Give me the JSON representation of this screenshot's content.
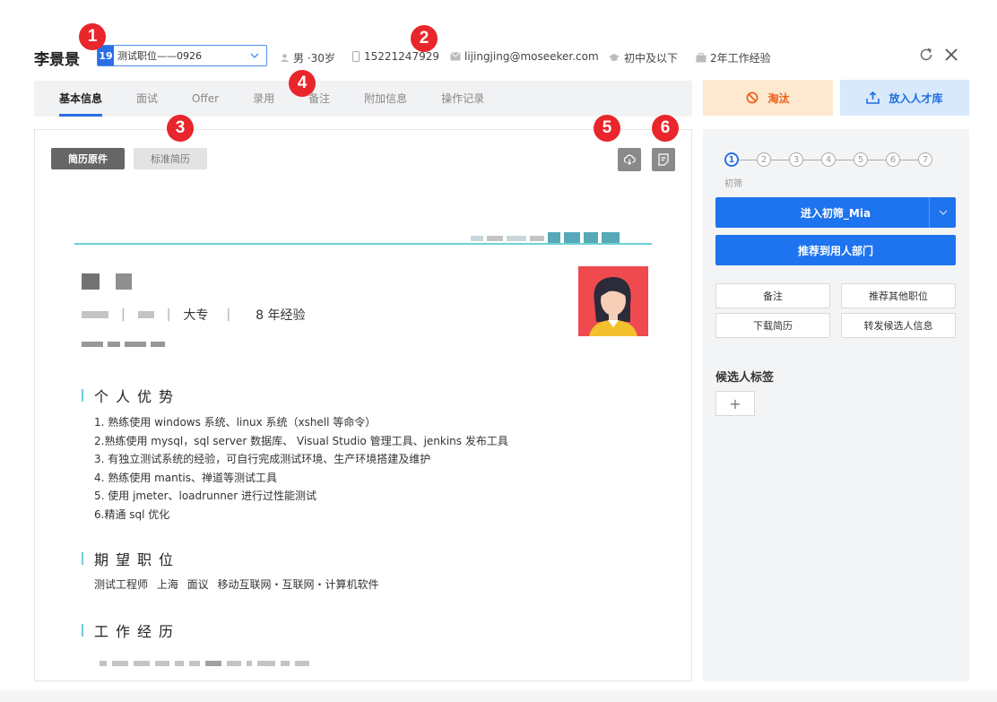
{
  "header": {
    "candidate_name": "李景景",
    "job_number": "19",
    "job_title": "测试职位——0926",
    "gender_age": "男 ·30岁",
    "phone": "15221247929",
    "email": "lijingjing@moseeker.com",
    "education": "初中及以下",
    "experience": "2年工作经验",
    "icons": [
      "user-icon",
      "phone-icon",
      "mail-icon",
      "graduation-cap-icon",
      "briefcase-icon",
      "refresh-icon",
      "close-icon"
    ]
  },
  "tabs": [
    {
      "label": "基本信息",
      "active": true
    },
    {
      "label": "面试",
      "active": false
    },
    {
      "label": "Offer",
      "active": false
    },
    {
      "label": "录用",
      "active": false
    },
    {
      "label": "备注",
      "active": false
    },
    {
      "label": "附加信息",
      "active": false
    },
    {
      "label": "操作记录",
      "active": false
    }
  ],
  "actions": {
    "eliminate": "淘汰",
    "talent_pool": "放入人才库"
  },
  "resume": {
    "view_original": "简历原件",
    "view_standard": "标准简历",
    "tools": [
      "cloud-download-icon",
      "note-icon"
    ],
    "personal": {
      "education": "大专",
      "years": "8 年经验"
    },
    "advantages_title": "个人优势",
    "advantages": [
      "1. 熟练使用 windows 系统、linux 系统（xshell 等命令）",
      "2.熟练使用 mysql，sql server 数据库、 Visual Studio 管理工具、jenkins 发布工具",
      "3. 有独立测试系统的经验，可自行完成测试环境、生产环境搭建及维护",
      "4. 熟练使用 mantis、禅道等测试工具",
      "5. 使用 jmeter、loadrunner 进行过性能测试",
      "6.精通 sql 优化"
    ],
    "expect_title": "期望职位",
    "expect": "测试工程师 上海 面议 移动互联网・互联网・计算机软件",
    "work_title": "工作经历"
  },
  "side": {
    "steps": [
      "1",
      "2",
      "3",
      "4",
      "5",
      "6",
      "7"
    ],
    "active_step": 1,
    "step_label": "初筛",
    "primary_button": "进入初筛_Mia",
    "recommend_button": "推荐到用人部门",
    "small_buttons": [
      "备注",
      "推荐其他职位",
      "下载简历",
      "转发候选人信息"
    ],
    "tags_title": "候选人标签",
    "add_tag": "+"
  },
  "markers": [
    "1",
    "2",
    "3",
    "4",
    "5",
    "6"
  ],
  "colors": {
    "accent": "#1e73ee",
    "marker": "#e8262b",
    "eliminate_bg": "#fde9cf",
    "eliminate_text": "#ef5a16",
    "talent_bg": "#d8e9fb",
    "resume_accent": "#6fd0d6"
  }
}
